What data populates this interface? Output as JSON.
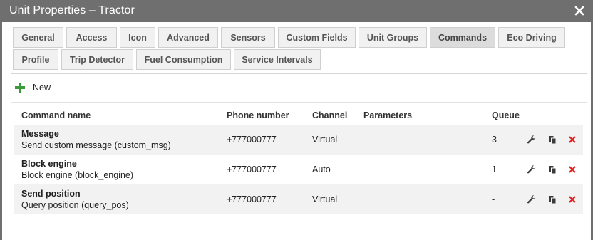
{
  "window": {
    "title": "Unit Properties – Tractor",
    "close_glyph": "✕"
  },
  "tabs": [
    {
      "label": "General"
    },
    {
      "label": "Access"
    },
    {
      "label": "Icon"
    },
    {
      "label": "Advanced"
    },
    {
      "label": "Sensors"
    },
    {
      "label": "Custom Fields"
    },
    {
      "label": "Unit Groups"
    },
    {
      "label": "Commands",
      "active": true
    },
    {
      "label": "Eco Driving"
    },
    {
      "label": "Profile"
    },
    {
      "label": "Trip Detector"
    },
    {
      "label": "Fuel Consumption"
    },
    {
      "label": "Service Intervals"
    }
  ],
  "toolbar": {
    "new_label": "New",
    "new_icon": "plus-icon"
  },
  "table": {
    "headers": {
      "name": "Command name",
      "phone": "Phone number",
      "channel": "Channel",
      "parameters": "Parameters",
      "queue": "Queue"
    },
    "rows": [
      {
        "name": "Message",
        "description": "Send custom message (custom_msg)",
        "phone": "+777000777",
        "channel": "Virtual",
        "parameters": "",
        "queue": "3"
      },
      {
        "name": "Block engine",
        "description": "Block engine (block_engine)",
        "phone": "+777000777",
        "channel": "Auto",
        "parameters": "",
        "queue": "1"
      },
      {
        "name": "Send position",
        "description": "Query position (query_pos)",
        "phone": "+777000777",
        "channel": "Virtual",
        "parameters": "",
        "queue": "-"
      }
    ],
    "row_actions": [
      "wrench-icon",
      "copy-icon",
      "delete-icon"
    ]
  },
  "colors": {
    "titlebar": "#6f6f6f",
    "active_tab": "#dcdcdc",
    "add_green": "#3a9a3a",
    "delete_red": "#e02020"
  }
}
